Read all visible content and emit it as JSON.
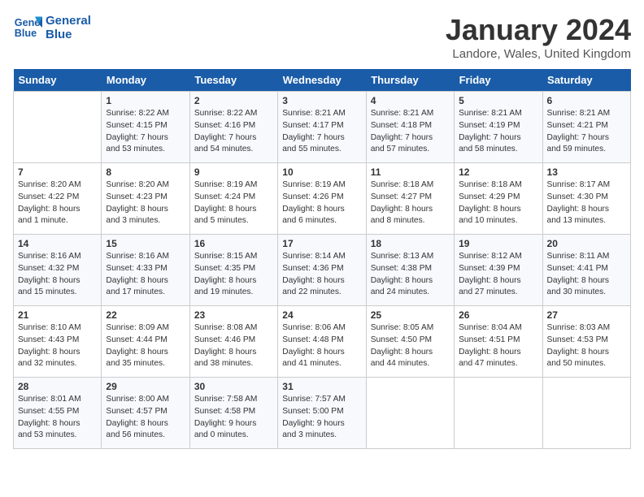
{
  "header": {
    "logo_line1": "General",
    "logo_line2": "Blue",
    "month": "January 2024",
    "location": "Landore, Wales, United Kingdom"
  },
  "days_of_week": [
    "Sunday",
    "Monday",
    "Tuesday",
    "Wednesday",
    "Thursday",
    "Friday",
    "Saturday"
  ],
  "weeks": [
    [
      {
        "day": "",
        "info": ""
      },
      {
        "day": "1",
        "info": "Sunrise: 8:22 AM\nSunset: 4:15 PM\nDaylight: 7 hours\nand 53 minutes."
      },
      {
        "day": "2",
        "info": "Sunrise: 8:22 AM\nSunset: 4:16 PM\nDaylight: 7 hours\nand 54 minutes."
      },
      {
        "day": "3",
        "info": "Sunrise: 8:21 AM\nSunset: 4:17 PM\nDaylight: 7 hours\nand 55 minutes."
      },
      {
        "day": "4",
        "info": "Sunrise: 8:21 AM\nSunset: 4:18 PM\nDaylight: 7 hours\nand 57 minutes."
      },
      {
        "day": "5",
        "info": "Sunrise: 8:21 AM\nSunset: 4:19 PM\nDaylight: 7 hours\nand 58 minutes."
      },
      {
        "day": "6",
        "info": "Sunrise: 8:21 AM\nSunset: 4:21 PM\nDaylight: 7 hours\nand 59 minutes."
      }
    ],
    [
      {
        "day": "7",
        "info": "Sunrise: 8:20 AM\nSunset: 4:22 PM\nDaylight: 8 hours\nand 1 minute."
      },
      {
        "day": "8",
        "info": "Sunrise: 8:20 AM\nSunset: 4:23 PM\nDaylight: 8 hours\nand 3 minutes."
      },
      {
        "day": "9",
        "info": "Sunrise: 8:19 AM\nSunset: 4:24 PM\nDaylight: 8 hours\nand 5 minutes."
      },
      {
        "day": "10",
        "info": "Sunrise: 8:19 AM\nSunset: 4:26 PM\nDaylight: 8 hours\nand 6 minutes."
      },
      {
        "day": "11",
        "info": "Sunrise: 8:18 AM\nSunset: 4:27 PM\nDaylight: 8 hours\nand 8 minutes."
      },
      {
        "day": "12",
        "info": "Sunrise: 8:18 AM\nSunset: 4:29 PM\nDaylight: 8 hours\nand 10 minutes."
      },
      {
        "day": "13",
        "info": "Sunrise: 8:17 AM\nSunset: 4:30 PM\nDaylight: 8 hours\nand 13 minutes."
      }
    ],
    [
      {
        "day": "14",
        "info": "Sunrise: 8:16 AM\nSunset: 4:32 PM\nDaylight: 8 hours\nand 15 minutes."
      },
      {
        "day": "15",
        "info": "Sunrise: 8:16 AM\nSunset: 4:33 PM\nDaylight: 8 hours\nand 17 minutes."
      },
      {
        "day": "16",
        "info": "Sunrise: 8:15 AM\nSunset: 4:35 PM\nDaylight: 8 hours\nand 19 minutes."
      },
      {
        "day": "17",
        "info": "Sunrise: 8:14 AM\nSunset: 4:36 PM\nDaylight: 8 hours\nand 22 minutes."
      },
      {
        "day": "18",
        "info": "Sunrise: 8:13 AM\nSunset: 4:38 PM\nDaylight: 8 hours\nand 24 minutes."
      },
      {
        "day": "19",
        "info": "Sunrise: 8:12 AM\nSunset: 4:39 PM\nDaylight: 8 hours\nand 27 minutes."
      },
      {
        "day": "20",
        "info": "Sunrise: 8:11 AM\nSunset: 4:41 PM\nDaylight: 8 hours\nand 30 minutes."
      }
    ],
    [
      {
        "day": "21",
        "info": "Sunrise: 8:10 AM\nSunset: 4:43 PM\nDaylight: 8 hours\nand 32 minutes."
      },
      {
        "day": "22",
        "info": "Sunrise: 8:09 AM\nSunset: 4:44 PM\nDaylight: 8 hours\nand 35 minutes."
      },
      {
        "day": "23",
        "info": "Sunrise: 8:08 AM\nSunset: 4:46 PM\nDaylight: 8 hours\nand 38 minutes."
      },
      {
        "day": "24",
        "info": "Sunrise: 8:06 AM\nSunset: 4:48 PM\nDaylight: 8 hours\nand 41 minutes."
      },
      {
        "day": "25",
        "info": "Sunrise: 8:05 AM\nSunset: 4:50 PM\nDaylight: 8 hours\nand 44 minutes."
      },
      {
        "day": "26",
        "info": "Sunrise: 8:04 AM\nSunset: 4:51 PM\nDaylight: 8 hours\nand 47 minutes."
      },
      {
        "day": "27",
        "info": "Sunrise: 8:03 AM\nSunset: 4:53 PM\nDaylight: 8 hours\nand 50 minutes."
      }
    ],
    [
      {
        "day": "28",
        "info": "Sunrise: 8:01 AM\nSunset: 4:55 PM\nDaylight: 8 hours\nand 53 minutes."
      },
      {
        "day": "29",
        "info": "Sunrise: 8:00 AM\nSunset: 4:57 PM\nDaylight: 8 hours\nand 56 minutes."
      },
      {
        "day": "30",
        "info": "Sunrise: 7:58 AM\nSunset: 4:58 PM\nDaylight: 9 hours\nand 0 minutes."
      },
      {
        "day": "31",
        "info": "Sunrise: 7:57 AM\nSunset: 5:00 PM\nDaylight: 9 hours\nand 3 minutes."
      },
      {
        "day": "",
        "info": ""
      },
      {
        "day": "",
        "info": ""
      },
      {
        "day": "",
        "info": ""
      }
    ]
  ]
}
